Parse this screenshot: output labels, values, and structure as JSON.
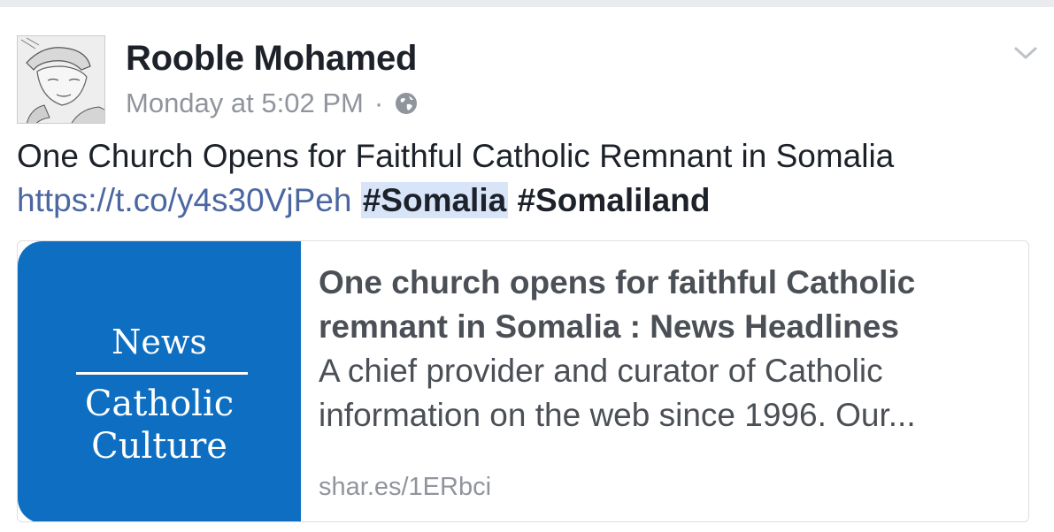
{
  "post": {
    "author": "Rooble Mohamed",
    "timestamp": "Monday at 5:02 PM",
    "separator": "·",
    "privacy_icon": "globe-icon",
    "options_icon": "chevron-down-icon",
    "text_line1": "One Church Opens for Faithful Catholic Remnant in Somalia",
    "link": "https://t.co/y4s30VjPeh",
    "hashtag1": "#Somalia",
    "hashtag2": "#Somaliland"
  },
  "card": {
    "thumb_top": "News",
    "thumb_line1": "Catholic",
    "thumb_line2": "Culture",
    "title_line1": "One church opens for faithful Catholic",
    "title_line2": "remnant in Somalia : News Headlines",
    "desc_line1": "A chief provider and curator of Catholic",
    "desc_line2": "information on the web since 1996. Our...",
    "domain": "shar.es/1ERbci"
  },
  "colors": {
    "link": "#4b67a1",
    "thumb_bg": "#0e6fc2",
    "hashtag_highlight": "#d8e4f7",
    "meta_gray": "#90949c"
  }
}
